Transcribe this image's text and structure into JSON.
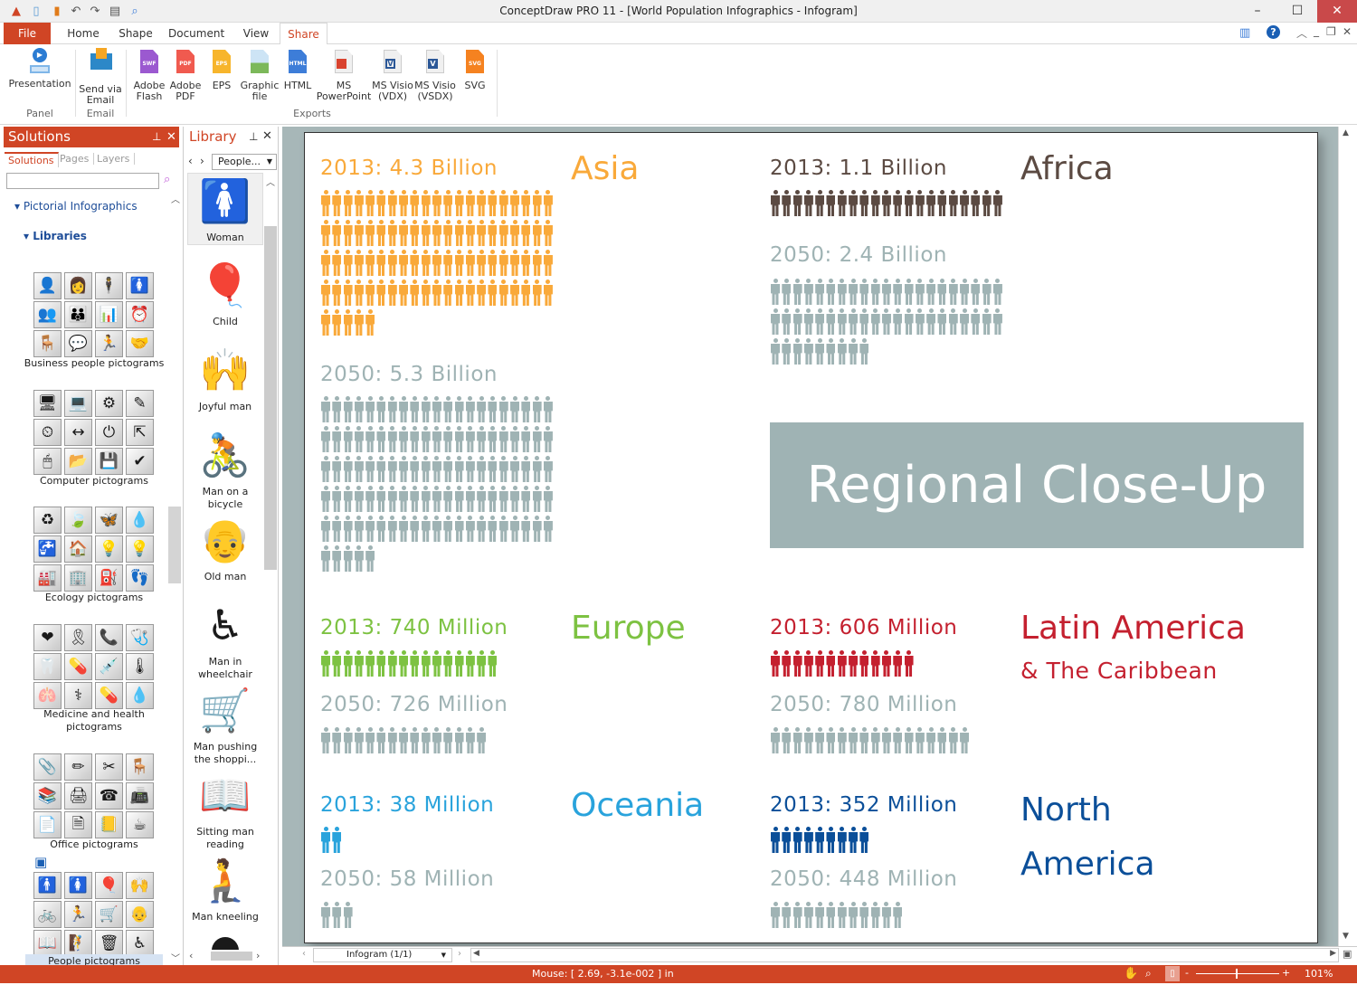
{
  "window": {
    "title": "ConceptDraw PRO 11 - [World Population Infographics - Infogram]",
    "minimize": "–",
    "maximize": "☐",
    "close": "✕"
  },
  "quick_access": [
    "app-icon",
    "new-icon",
    "open-icon",
    "undo-icon",
    "redo-icon",
    "save-icon",
    "print-preview-icon"
  ],
  "ribbon": {
    "tabs": [
      {
        "label": "File"
      },
      {
        "label": "Home"
      },
      {
        "label": "Shape"
      },
      {
        "label": "Document"
      },
      {
        "label": "View"
      },
      {
        "label": "Share",
        "active": true
      }
    ],
    "buttons": [
      {
        "label": "Presentation",
        "icon": "presentation-icon"
      },
      {
        "label": "Send via Email",
        "icon": "email-icon"
      },
      {
        "label": "Adobe Flash",
        "icon": "swf-file-icon",
        "badge": "SWF",
        "color": "#9b59d0"
      },
      {
        "label": "Adobe PDF",
        "icon": "pdf-file-icon",
        "badge": "PDF",
        "color": "#f05a4f"
      },
      {
        "label": "EPS",
        "icon": "eps-file-icon",
        "badge": "EPS",
        "color": "#f7b52c"
      },
      {
        "label": "Graphic file",
        "icon": "image-file-icon"
      },
      {
        "label": "HTML",
        "icon": "html-file-icon",
        "badge": "HTML",
        "color": "#3d7dd8"
      },
      {
        "label": "MS PowerPoint",
        "icon": "powerpoint-icon"
      },
      {
        "label": "MS Visio (VDX)",
        "icon": "visio-vdx-icon"
      },
      {
        "label": "MS Visio (VSDX)",
        "icon": "visio-vsdx-icon"
      },
      {
        "label": "SVG",
        "icon": "svg-file-icon",
        "badge": "SVG",
        "color": "#f58220"
      }
    ],
    "groups": {
      "panel": "Panel",
      "email": "Email",
      "exports": "Exports"
    }
  },
  "solutions_panel": {
    "title": "Solutions",
    "tabs": [
      "Solutions",
      "Pages",
      "Layers"
    ],
    "search_value": "",
    "tree": {
      "root": "Pictorial Infographics",
      "child": "Libraries"
    },
    "libraries": [
      {
        "label": "Business people pictograms",
        "icons": [
          "👤",
          "👩",
          "🕴",
          "🚺",
          "👥",
          "👪",
          "📊",
          "⏰",
          "🪑",
          "💬",
          "🏃",
          "🤝"
        ]
      },
      {
        "label": "Computer pictograms",
        "icons": [
          "🖥",
          "💻",
          "⚙",
          "✎",
          "⏲",
          "↔",
          "⏻",
          "⇱",
          "🖱",
          "📂",
          "💾",
          "✔"
        ]
      },
      {
        "label": "Ecology pictograms",
        "icons": [
          "♻",
          "🍃",
          "🦋",
          "💧",
          "🚰",
          "🏠",
          "💡",
          "💡",
          "🏭",
          "🏢",
          "⛽",
          "👣"
        ]
      },
      {
        "label": "Medicine and health pictograms",
        "icons": [
          "❤",
          "🎗",
          "📞",
          "🩺",
          "🦷",
          "💊",
          "💉",
          "🌡",
          "🫁",
          "⚕",
          "💊",
          "💧"
        ]
      },
      {
        "label": "Office pictograms",
        "icons": [
          "📎",
          "✏",
          "✂",
          "🪑",
          "📚",
          "🖨",
          "☎",
          "📠",
          "📄",
          "🗎",
          "📒",
          "☕"
        ]
      },
      {
        "label": "People pictograms",
        "icons": [
          "🚹",
          "🚺",
          "🎈",
          "🙌",
          "🚲",
          "🏃",
          "🛒",
          "👴",
          "📖",
          "🧗",
          "🗑",
          "♿"
        ]
      }
    ]
  },
  "library_panel": {
    "title": "Library",
    "dropdown_value": "People...",
    "items": [
      {
        "label": "Woman",
        "glyph": "🚺"
      },
      {
        "label": "Child",
        "glyph": "🎈"
      },
      {
        "label": "Joyful man",
        "glyph": "🙌"
      },
      {
        "label": "Man on a bicycle",
        "glyph": "🚴"
      },
      {
        "label": "Old man",
        "glyph": "👴"
      },
      {
        "label": "Man in wheelchair",
        "glyph": "♿"
      },
      {
        "label": "Man pushing the shoppi...",
        "glyph": "🛒"
      },
      {
        "label": "Sitting man reading",
        "glyph": "📖"
      },
      {
        "label": "Man kneeling",
        "glyph": "🧎"
      }
    ]
  },
  "infographic": {
    "banner": "Regional Close-Up",
    "regions": [
      {
        "name": "Asia",
        "color": "#f9a93a",
        "y2013": "2013: 4.3 Billion",
        "y2050": "2050: 5.3 Billion",
        "icons2013": 89,
        "icons2050": 110
      },
      {
        "name": "Africa",
        "color": "#5b4a42",
        "y2013": "2013: 1.1 Billion",
        "y2050": "2050: 2.4 Billion",
        "icons2013": 21,
        "icons2050": 51
      },
      {
        "name": "Europe",
        "color": "#7dc242",
        "y2013": "2013: 740 Million",
        "y2050": "2050: 726 Million",
        "icons2013": 16,
        "icons2050": 15
      },
      {
        "name": "Latin America",
        "subtitle": "& The Caribbean",
        "color": "#c4202f",
        "y2013": "2013: 606 Million",
        "y2050": "2050: 780 Million",
        "icons2013": 13,
        "icons2050": 18
      },
      {
        "name": "Oceania",
        "color": "#29a3dc",
        "y2013": "2013: 38 Million",
        "y2050": "2050: 58 Million",
        "icons2013": 2,
        "icons2050": 3
      },
      {
        "name": "North America",
        "color": "#0b4f99",
        "y2013": "2013: 352 Million",
        "y2050": "2050: 448 Million",
        "icons2013": 9,
        "icons2050": 12
      }
    ],
    "future_color": "#9fb3b4"
  },
  "page_tab": "Infogram (1/1)",
  "status": {
    "mouse": "Mouse: [ 2.69, -3.1e-002 ] in",
    "zoom": "101%"
  }
}
